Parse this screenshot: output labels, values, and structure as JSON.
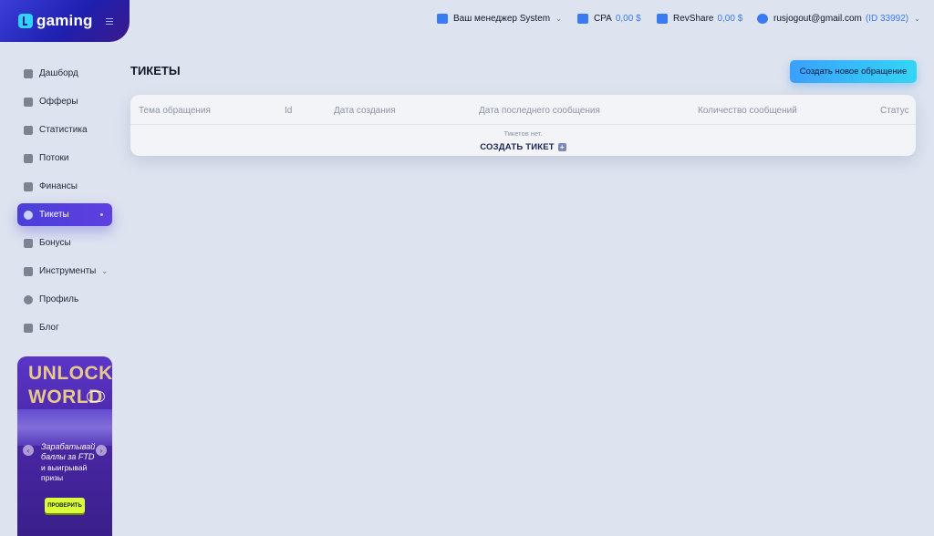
{
  "brand": {
    "name": "gaming"
  },
  "header": {
    "manager_label": "Ваш менеджер System",
    "cpa_label": "CPA",
    "cpa_value": "0,00 $",
    "revshare_label": "RevShare",
    "revshare_value": "0,00 $",
    "user_email": "rusjogout@gmail.com",
    "user_id": "(ID 33992)"
  },
  "sidebar": {
    "items": [
      {
        "label": "Дашборд",
        "icon": "dashboard-icon"
      },
      {
        "label": "Офферы",
        "icon": "offers-icon"
      },
      {
        "label": "Статистика",
        "icon": "statistics-icon"
      },
      {
        "label": "Потоки",
        "icon": "streams-icon"
      },
      {
        "label": "Финансы",
        "icon": "finance-icon"
      },
      {
        "label": "Тикеты",
        "icon": "headset-icon",
        "active": true
      },
      {
        "label": "Бонусы",
        "icon": "bonus-icon"
      },
      {
        "label": "Инструменты",
        "icon": "tools-icon"
      },
      {
        "label": "Профиль",
        "icon": "profile-icon"
      },
      {
        "label": "Блог",
        "icon": "blog-icon"
      }
    ]
  },
  "banner": {
    "line1": "UNLOCK",
    "line2": "WORLD",
    "promo": "Зарабатывай баллы за FTD",
    "promo_sub": "и выигрывай призы",
    "button": "ПРОВЕРИТЬ"
  },
  "main": {
    "title": "ТИКЕТЫ",
    "create_button": "Создать новое обращение",
    "columns": [
      "Тема обращения",
      "Id",
      "Дата создания",
      "Дата последнего сообщения",
      "Количество сообщений",
      "Статус"
    ],
    "empty_text": "Тикетов нет.",
    "empty_link": "СОЗДАТЬ ТИКЕТ"
  },
  "colors": {
    "accent": "#3a7bf4",
    "active_nav": "#4b3fd8",
    "background": "#dde3ef"
  }
}
